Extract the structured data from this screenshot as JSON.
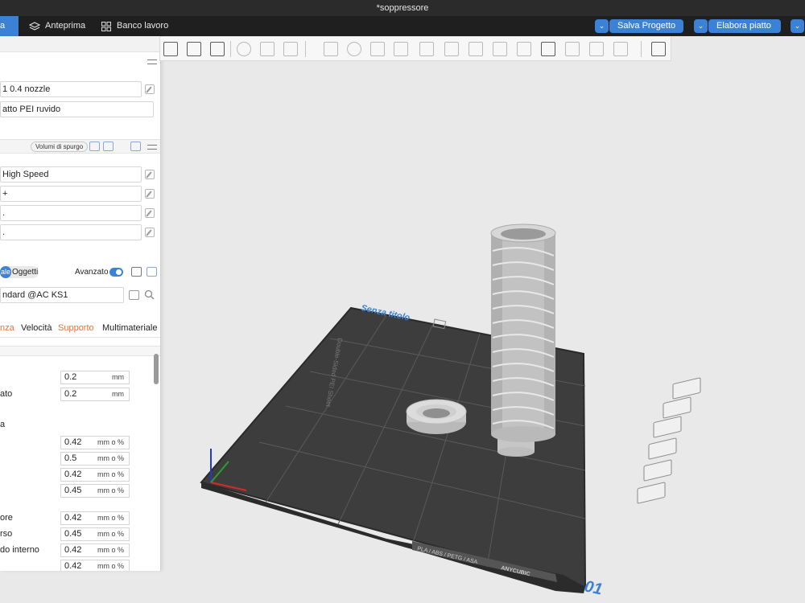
{
  "window": {
    "title": "*soppressore"
  },
  "topbar": {
    "active_tab": "a",
    "tabs": [
      {
        "label": "Anteprima",
        "icon": "layers-icon"
      },
      {
        "label": "Banco lavoro",
        "icon": "grid-icon"
      }
    ],
    "save_label": "Salva Progetto",
    "slice_label": "Elabora piatto"
  },
  "printer": {
    "nozzle": "1 0.4 nozzle",
    "plate": "atto PEI ruvido"
  },
  "filament": {
    "purge_label": "Volumi di spurgo",
    "slots": [
      "High Speed",
      "+",
      ".",
      "."
    ]
  },
  "process": {
    "seg_global": "ale",
    "seg_objects": "Oggetti",
    "advanced_label": "Avanzato",
    "profile": "ndard @AC KS1",
    "tabs": [
      {
        "label": "nza",
        "accent": true
      },
      {
        "label": "Velocità",
        "accent": false
      },
      {
        "label": "Supporto",
        "accent": true
      },
      {
        "label": "Multimateriale",
        "accent": false
      }
    ],
    "group_label": "a",
    "rows": [
      {
        "label": "",
        "value": "0.2",
        "unit": "mm"
      },
      {
        "label": "ato",
        "value": "0.2",
        "unit": "mm"
      },
      {
        "label": "",
        "value": "0.42",
        "unit": "mm o %"
      },
      {
        "label": "",
        "value": "0.5",
        "unit": "mm o %"
      },
      {
        "label": "",
        "value": "0.42",
        "unit": "mm o %"
      },
      {
        "label": "",
        "value": "0.45",
        "unit": "mm o %"
      },
      {
        "label": "ore",
        "value": "0.42",
        "unit": "mm o %"
      },
      {
        "label": "rso",
        "value": "0.45",
        "unit": "mm o %"
      },
      {
        "label": "do interno",
        "value": "0.42",
        "unit": "mm o %"
      },
      {
        "label": "",
        "value": "0.42",
        "unit": "mm o %"
      }
    ]
  },
  "canvas": {
    "plate_name": "Senza titolo",
    "plate_number": "01",
    "sheet_text": "Double-Sided PEI Sheet",
    "material_text": "PLA / ABS / PETG / ASA",
    "brand_text": "ANYCUBIC"
  },
  "colors": {
    "accent": "#3b82d6",
    "tab_accent": "#e8703a",
    "plate": "#3a3a3a"
  }
}
